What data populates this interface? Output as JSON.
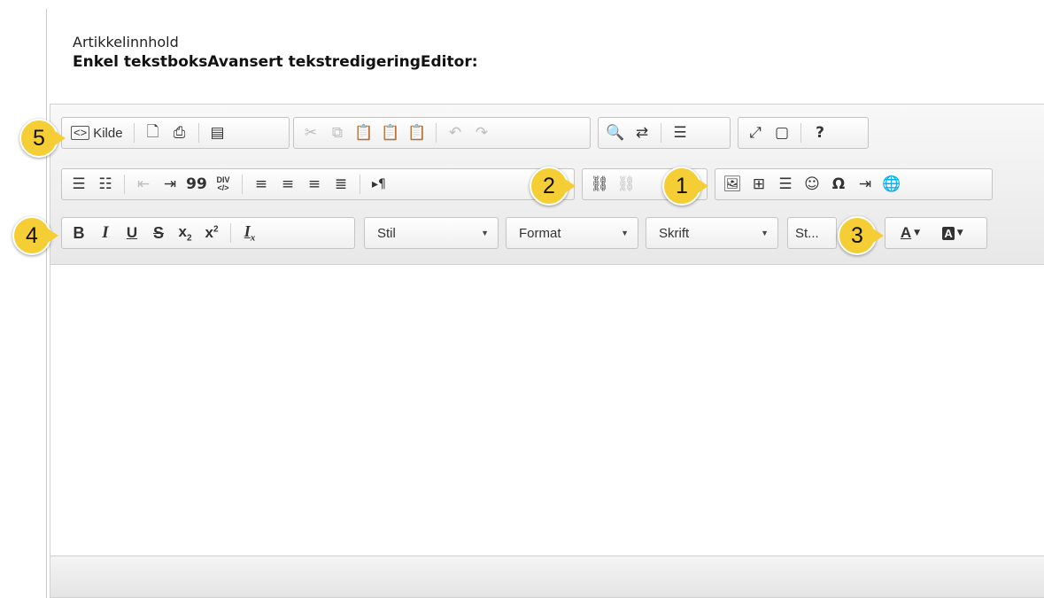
{
  "field": {
    "label": "Artikkelinnhold",
    "sublabel": "Enkel tekstboksAvansert tekstredigeringEditor:"
  },
  "toolbar": {
    "row1": {
      "source_label": "Kilde",
      "source_icon": "source-icon",
      "preview_icon": "preview-icon",
      "print_icon": "print-icon",
      "templates_icon": "templates-icon",
      "cut_icon": "cut-icon",
      "copy_icon": "copy-icon",
      "paste_icon": "paste-icon",
      "paste_text_icon": "paste-text-icon",
      "paste_word_icon": "paste-word-icon",
      "undo_icon": "undo-icon",
      "redo_icon": "redo-icon",
      "find_icon": "find-icon",
      "replace_icon": "replace-icon",
      "spellcheck_icon": "spellcheck-icon",
      "maximize_icon": "maximize-icon",
      "show_blocks_icon": "show-blocks-icon",
      "help_label": "?"
    },
    "row2": {
      "numbered_list_icon": "numbered-list-icon",
      "bulleted_list_icon": "bulleted-list-icon",
      "outdent_icon": "outdent-icon",
      "indent_icon": "indent-icon",
      "blockquote_label": "99",
      "div_label_top": "DIV",
      "div_label_bottom": "</>",
      "align_left_icon": "align-left-icon",
      "align_center_icon": "align-center-icon",
      "align_right_icon": "align-right-icon",
      "justify_icon": "justify-icon",
      "ltr_label": "▸¶",
      "link_icon": "link-icon",
      "unlink_icon": "unlink-icon",
      "image_icon": "image-icon",
      "table_icon": "table-icon",
      "hr_icon": "horizontal-line-icon",
      "smiley_icon": "smiley-icon",
      "special_char_label": "Ω",
      "page_break_icon": "page-break-icon",
      "iframe_icon": "globe-icon"
    },
    "row3": {
      "bold_label": "B",
      "italic_label": "I",
      "underline_label": "U",
      "strike_label": "S",
      "subscript_label": "x",
      "subscript_sub": "2",
      "superscript_label": "x",
      "superscript_sup": "2",
      "remove_format_label": "I",
      "remove_format_sub": "x",
      "style_combo": "Stil",
      "format_combo": "Format",
      "font_combo": "Skrift",
      "size_combo": "St...",
      "text_color_label": "A",
      "bg_color_label": "A"
    }
  },
  "callouts": [
    "5",
    "2",
    "1",
    "4",
    "3"
  ],
  "colors": {
    "callout_fill": "#f5cd34",
    "toolbar_bg": "#f0f0f0",
    "border": "#c4c4c4",
    "text_color_underline": "#222222"
  }
}
